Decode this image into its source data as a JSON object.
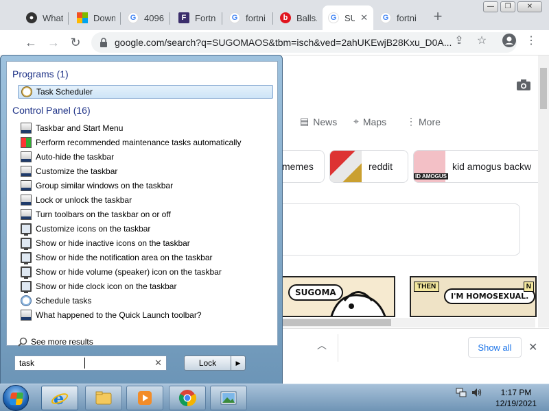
{
  "browser": {
    "tabs": [
      {
        "label": "What",
        "favicon": "github-icon",
        "color": "#333333"
      },
      {
        "label": "Down",
        "favicon": "microsoft-icon",
        "color": "#f25022"
      },
      {
        "label": "4096",
        "favicon": "google-icon",
        "color": "#4285f4"
      },
      {
        "label": "Fortn",
        "favicon": "fandom-icon",
        "color": "#3a2d6b"
      },
      {
        "label": "fortni",
        "favicon": "google-icon",
        "color": "#4285f4"
      },
      {
        "label": "Balls.c",
        "favicon": "b-icon",
        "color": "#e0141e"
      },
      {
        "label": "SU",
        "favicon": "google-icon",
        "color": "#4285f4",
        "active": true
      },
      {
        "label": "fortni",
        "favicon": "google-icon",
        "color": "#4285f4"
      }
    ],
    "url": "google.com/search?q=SUGOMAOS&tbm=isch&ved=2ahUKEwjB28Kxu_D0A..."
  },
  "page": {
    "search_tabs": [
      {
        "label": "News",
        "icon": "news-icon"
      },
      {
        "label": "Maps",
        "icon": "map-pin-icon"
      },
      {
        "label": "More",
        "icon": "kebab-icon"
      }
    ],
    "chips": [
      "memes",
      "reddit",
      "kid amogus backw"
    ],
    "chip_thumb_text": "ID AMOGUS",
    "comic": {
      "left_text": "SUGOMA",
      "right_label": "THEN",
      "right_text": "I'M HOMOSEXUAL.",
      "right_edge": "N"
    },
    "show_all": "Show all"
  },
  "start_menu": {
    "programs_heading": "Programs (1)",
    "programs": [
      {
        "label": "Task Scheduler",
        "icon": "clock-icon"
      }
    ],
    "control_panel_heading": "Control Panel (16)",
    "control_panel": [
      {
        "label": "Taskbar and Start Menu",
        "icon": "taskbar-icon"
      },
      {
        "label": "Perform recommended maintenance tasks automatically",
        "icon": "action-center-icon"
      },
      {
        "label": "Auto-hide the taskbar",
        "icon": "taskbar-icon"
      },
      {
        "label": "Customize the taskbar",
        "icon": "taskbar-icon"
      },
      {
        "label": "Group similar windows on the taskbar",
        "icon": "taskbar-icon"
      },
      {
        "label": "Lock or unlock the taskbar",
        "icon": "taskbar-icon"
      },
      {
        "label": "Turn toolbars on the taskbar on or off",
        "icon": "taskbar-icon"
      },
      {
        "label": "Customize icons on the taskbar",
        "icon": "notification-icons-icon"
      },
      {
        "label": "Show or hide inactive icons on the taskbar",
        "icon": "notification-icons-icon"
      },
      {
        "label": "Show or hide the notification area on the taskbar",
        "icon": "notification-icons-icon"
      },
      {
        "label": "Show or hide volume (speaker) icon on the taskbar",
        "icon": "notification-icons-icon"
      },
      {
        "label": "Show or hide clock icon on the taskbar",
        "icon": "notification-icons-icon"
      },
      {
        "label": "Schedule tasks",
        "icon": "schedule-icon"
      },
      {
        "label": "What happened to the Quick Launch toolbar?",
        "icon": "taskbar-icon"
      }
    ],
    "see_more": "See more results",
    "search_value": "task",
    "power_button": "Lock"
  },
  "taskbar": {
    "pinned": [
      "internet-explorer-icon",
      "file-explorer-icon",
      "media-player-icon",
      "chrome-icon",
      "picture-viewer-icon"
    ],
    "time": "1:17 PM",
    "date": "12/19/2021"
  }
}
